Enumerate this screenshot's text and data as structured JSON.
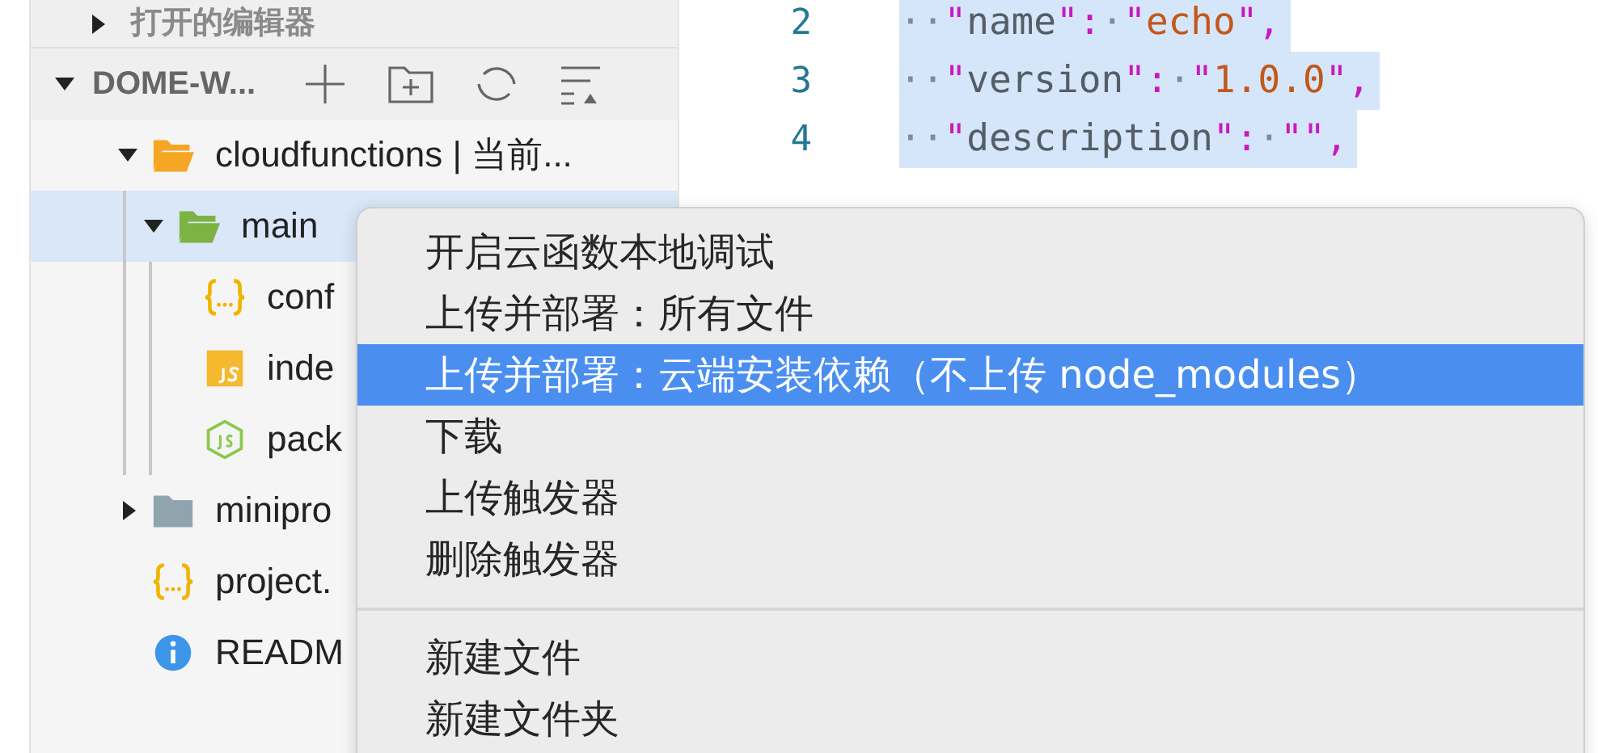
{
  "sidebar": {
    "open_editors": {
      "title": "打开的编辑器",
      "expanded": false
    },
    "workspace": {
      "title": "DOME-W...",
      "expanded": true
    },
    "tree": [
      {
        "label": "cloudfunctions | 当前...",
        "kind": "folder",
        "color": "#f5a623",
        "expanded": true,
        "selected": false,
        "children": [
          {
            "label": "main",
            "kind": "folder",
            "color": "#7cb342",
            "expanded": true,
            "selected": true,
            "children": [
              {
                "label": "conf",
                "kind": "json",
                "selected": false
              },
              {
                "label": "inde",
                "kind": "js",
                "selected": false
              },
              {
                "label": "pack",
                "kind": "node",
                "selected": false
              }
            ]
          }
        ]
      },
      {
        "label": "minipro",
        "kind": "folder",
        "color": "#90a4ae",
        "expanded": false,
        "selected": false
      },
      {
        "label": "project.",
        "kind": "json",
        "selected": false
      },
      {
        "label": "READM",
        "kind": "info",
        "selected": false
      }
    ]
  },
  "editor": {
    "lines": [
      {
        "number": "2",
        "text": "··\"name\":·\"echo\","
      },
      {
        "number": "3",
        "text": "··\"version\":·\"1.0.0\","
      },
      {
        "number": "4",
        "text": "··\"description\":·\"\","
      }
    ]
  },
  "context_menu": {
    "sections": [
      [
        {
          "label": "开启云函数本地调试",
          "selected": false
        },
        {
          "label": "上传并部署：所有文件",
          "selected": false
        },
        {
          "label": "上传并部署：云端安装依赖（不上传 node_modules）",
          "selected": true
        },
        {
          "label": "下载",
          "selected": false
        },
        {
          "label": "上传触发器",
          "selected": false
        },
        {
          "label": "删除触发器",
          "selected": false
        }
      ],
      [
        {
          "label": "新建文件",
          "selected": false
        },
        {
          "label": "新建文件夹",
          "selected": false
        }
      ]
    ]
  }
}
